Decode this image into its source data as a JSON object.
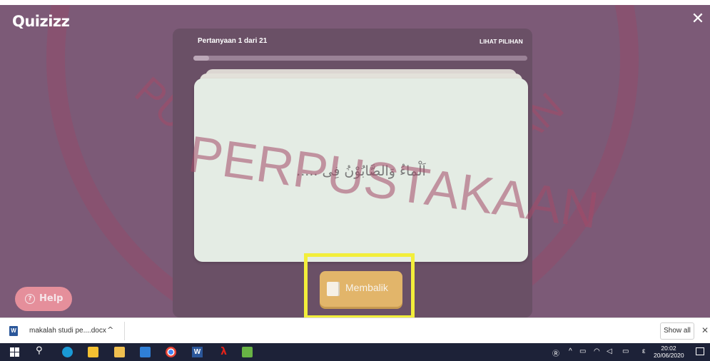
{
  "app": {
    "logo": "Quizizz",
    "close_symbol": "✕"
  },
  "quiz": {
    "question_counter": "Pertanyaan 1 dari 21",
    "options_link": "LIHAT PILIHAN",
    "progress_fraction": 0.048,
    "question_text": "اَلْماءُ وَالصَّابُوْنُ فِى .....",
    "flip_button": "Membalik",
    "help_button": "Help",
    "help_symbol": "?"
  },
  "watermark": {
    "text_main": "PERPUSTAKAAN",
    "text_left": "PUSAT",
    "text_right": "AAN"
  },
  "download_bar": {
    "file_name": "makalah studi pe....docx",
    "file_icon_letter": "W",
    "chevron": "^",
    "show_all": "Show all",
    "close": "✕"
  },
  "taskbar": {
    "word_letter": "W",
    "acrobat_symbol": "λ",
    "tray_user": "Ⓡ",
    "tray_arrow": "^",
    "tray_lang": "ε",
    "time": "20:02",
    "date": "20/06/2020"
  }
}
